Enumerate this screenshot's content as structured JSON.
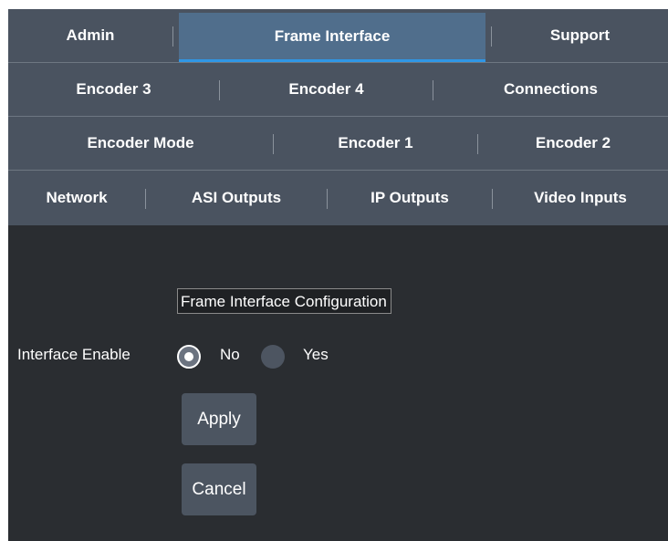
{
  "tabs": {
    "row1": [
      "Admin",
      "Frame Interface",
      "Support"
    ],
    "row2": [
      "Encoder 3",
      "Encoder 4",
      "Connections"
    ],
    "row3": [
      "Encoder Mode",
      "Encoder 1",
      "Encoder 2"
    ],
    "row4": [
      "Network",
      "ASI Outputs",
      "IP Outputs",
      "Video Inputs"
    ],
    "active": "Frame Interface"
  },
  "form": {
    "section_title": "Frame Interface Configuration",
    "interface_enable": {
      "label": "Interface Enable",
      "options": [
        "No",
        "Yes"
      ],
      "selected": "No"
    },
    "apply_label": "Apply",
    "cancel_label": "Cancel"
  },
  "colors": {
    "tab_bar": "#4a5360",
    "active_tab": "#506e8c",
    "active_underline": "#2f97e6",
    "content_bg": "#2a2d31",
    "button_bg": "#4c5561"
  }
}
